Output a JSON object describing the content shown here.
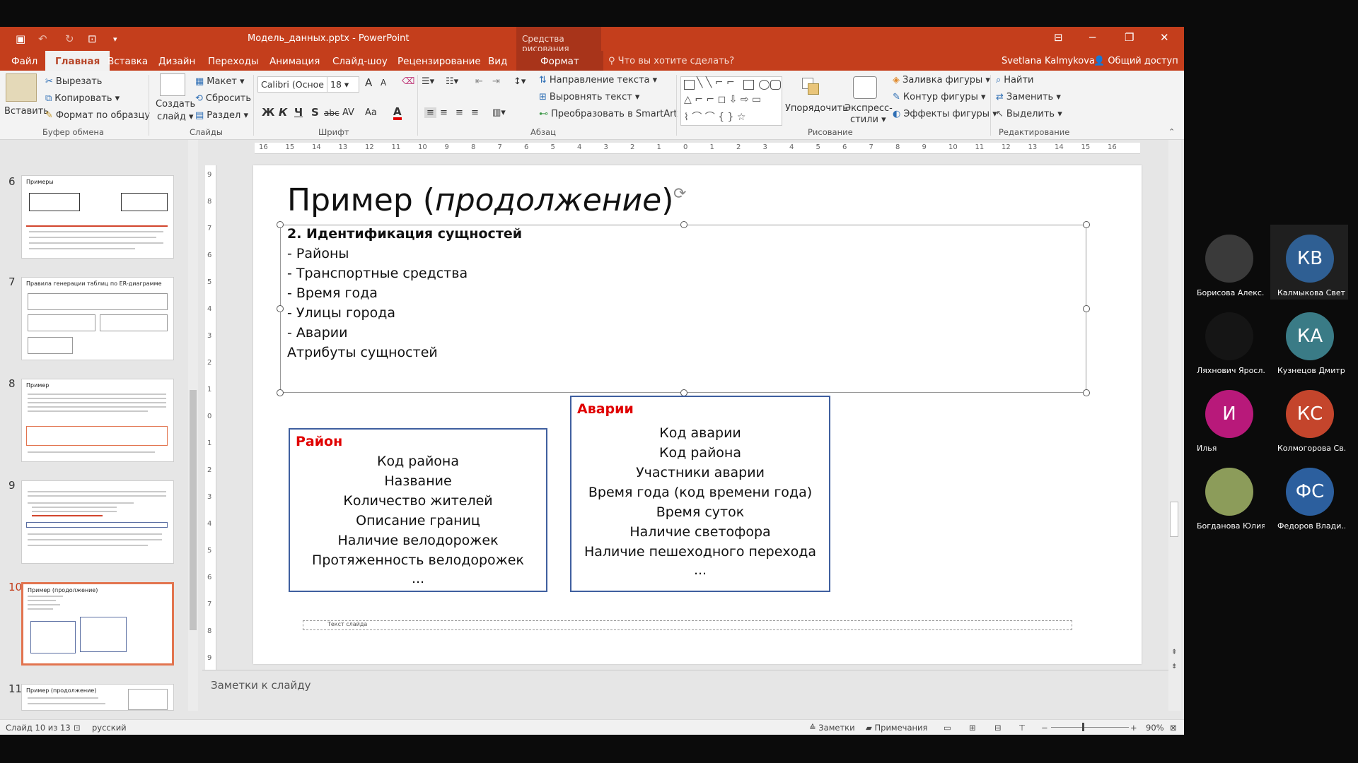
{
  "titlebar": {
    "doc_title": "Модель_данных.pptx - PowerPoint",
    "contextual": "Средства рисования"
  },
  "tabs": [
    {
      "label": "Файл"
    },
    {
      "label": "Главная"
    },
    {
      "label": "Вставка"
    },
    {
      "label": "Дизайн"
    },
    {
      "label": "Переходы"
    },
    {
      "label": "Анимация"
    },
    {
      "label": "Слайд-шоу"
    },
    {
      "label": "Рецензирование"
    },
    {
      "label": "Вид"
    },
    {
      "label": "Формат"
    }
  ],
  "tellme": "Что вы хотите сделать?",
  "user": "Svetlana Kalmykova",
  "share": "Общий доступ",
  "ribbon": {
    "paste": "Вставить",
    "cut": "Вырезать",
    "copy": "Копировать",
    "format_painter": "Формат по образцу",
    "clipboard_group": "Буфер обмена",
    "new_slide_1": "Создать",
    "new_slide_2": "слайд",
    "layout": "Макет",
    "reset": "Сбросить",
    "section": "Раздел",
    "slides_group": "Слайды",
    "font_name": "Calibri (Осное",
    "font_size": "18",
    "font_group": "Шрифт",
    "fmt_bold": "Ж",
    "fmt_italic": "К",
    "fmt_underline": "Ч",
    "fmt_shadow": "S",
    "fmt_strike": "abc",
    "fmt_spacing": "AV",
    "fmt_case": "Aa",
    "fmt_color": "A",
    "text_direction": "Направление текста",
    "align_text": "Выровнять текст",
    "smartart": "Преобразовать в SmartArt",
    "paragraph_group": "Абзац",
    "arrange": "Упорядочить",
    "quick_styles_1": "Экспресс-",
    "quick_styles_2": "стили",
    "shape_fill": "Заливка фигуры",
    "shape_outline": "Контур фигуры",
    "shape_effects": "Эффекты фигуры",
    "drawing_group": "Рисование",
    "find": "Найти",
    "replace": "Заменить",
    "select": "Выделить",
    "editing_group": "Редактирование"
  },
  "thumbnails": [
    {
      "num": "6",
      "title": "Примеры"
    },
    {
      "num": "7",
      "title": "Правила генерации таблиц по ER-диаграмме"
    },
    {
      "num": "8",
      "title": "Пример"
    },
    {
      "num": "9",
      "title": ""
    },
    {
      "num": "10",
      "title": "Пример (продолжение)"
    },
    {
      "num": "11",
      "title": "Пример (продолжение)"
    }
  ],
  "slide": {
    "title_main": "Пример (",
    "title_italic": "продолжение",
    "title_end": ")",
    "lines": [
      "2.   Идентификация сущностей",
      "-    Районы",
      "-    Транспортные средства",
      "-    Время года",
      "-    Улицы города",
      "-    Аварии",
      "Атрибуты сущностей"
    ],
    "entity1": {
      "name": "Район",
      "rows": [
        "Код района",
        "Название",
        "Количество жителей",
        "Описание границ",
        "Наличие велодорожек",
        "Протяженность велодорожек",
        "..."
      ]
    },
    "entity2": {
      "name": "Аварии",
      "rows": [
        "Код аварии",
        "Код района",
        "Участники аварии",
        "Время года (код времени года)",
        "Время суток",
        "Наличие светофора",
        "Наличие пешеходного перехода",
        "..."
      ]
    },
    "footer": "Текст слайда"
  },
  "notes_placeholder": "Заметки к слайду",
  "status": {
    "slide_count": "Слайд 10 из 13",
    "language": "русский",
    "notes": "Заметки",
    "comments": "Примечания",
    "zoom": "90%"
  },
  "participants": [
    {
      "initials": "",
      "name": "Борисова Алекс...",
      "color": "#3a3a3a"
    },
    {
      "initials": "КВ",
      "name": "Калмыкова Свет...",
      "color": "#2f5f93"
    },
    {
      "initials": "",
      "name": "Ляхнович Яросл...",
      "color": "#151515"
    },
    {
      "initials": "КА",
      "name": "Кузнецов Дмитр...",
      "color": "#3a7b86"
    },
    {
      "initials": "И",
      "name": "Илья",
      "color": "#b8197a"
    },
    {
      "initials": "КС",
      "name": "Колмогорова Св...",
      "color": "#c4452c"
    },
    {
      "initials": "",
      "name": "Богданова Юлия...",
      "color": "#8c9c5a"
    },
    {
      "initials": "ФС",
      "name": "Федоров Влади...",
      "color": "#2c5f9e"
    }
  ]
}
